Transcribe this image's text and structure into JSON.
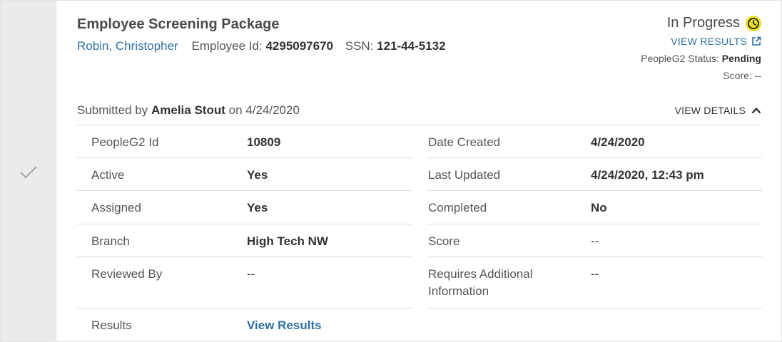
{
  "package": {
    "title": "Employee Screening Package",
    "employee_name": "Robin, Christopher",
    "employee_id_label": "Employee Id:",
    "employee_id": "4295097670",
    "ssn_label": "SSN:",
    "ssn": "121-44-5132"
  },
  "status": {
    "text": "In Progress",
    "icon": "clock-icon",
    "icon_color": "#e8e021",
    "view_results_label": "VIEW RESULTS",
    "peopleg2_status_label": "PeopleG2 Status:",
    "peopleg2_status": "Pending",
    "score_label": "Score:",
    "score": "--"
  },
  "submitted": {
    "prefix": "Submitted by",
    "name": "Amelia Stout",
    "on": "on",
    "date": "4/24/2020"
  },
  "details_toggle": {
    "label": "VIEW DETAILS",
    "expanded": true
  },
  "details": {
    "left": [
      {
        "label": "PeopleG2 Id",
        "value": "10809"
      },
      {
        "label": "Active",
        "value": "Yes"
      },
      {
        "label": "Assigned",
        "value": "Yes"
      },
      {
        "label": "Branch",
        "value": "High Tech NW"
      },
      {
        "label": "Reviewed By",
        "value": "--"
      },
      {
        "label": "Results",
        "value": "View Results"
      }
    ],
    "right": [
      {
        "label": "Date Created",
        "value": "4/24/2020"
      },
      {
        "label": "Last Updated",
        "value": "4/24/2020, 12:43 pm"
      },
      {
        "label": "Completed",
        "value": "No"
      },
      {
        "label": "Score",
        "value": "--"
      },
      {
        "label": "Requires Additional Information",
        "value": "--"
      }
    ]
  },
  "colors": {
    "link": "#2f6fa3",
    "rail": "#ebebeb",
    "status_icon": "#e8e021"
  }
}
